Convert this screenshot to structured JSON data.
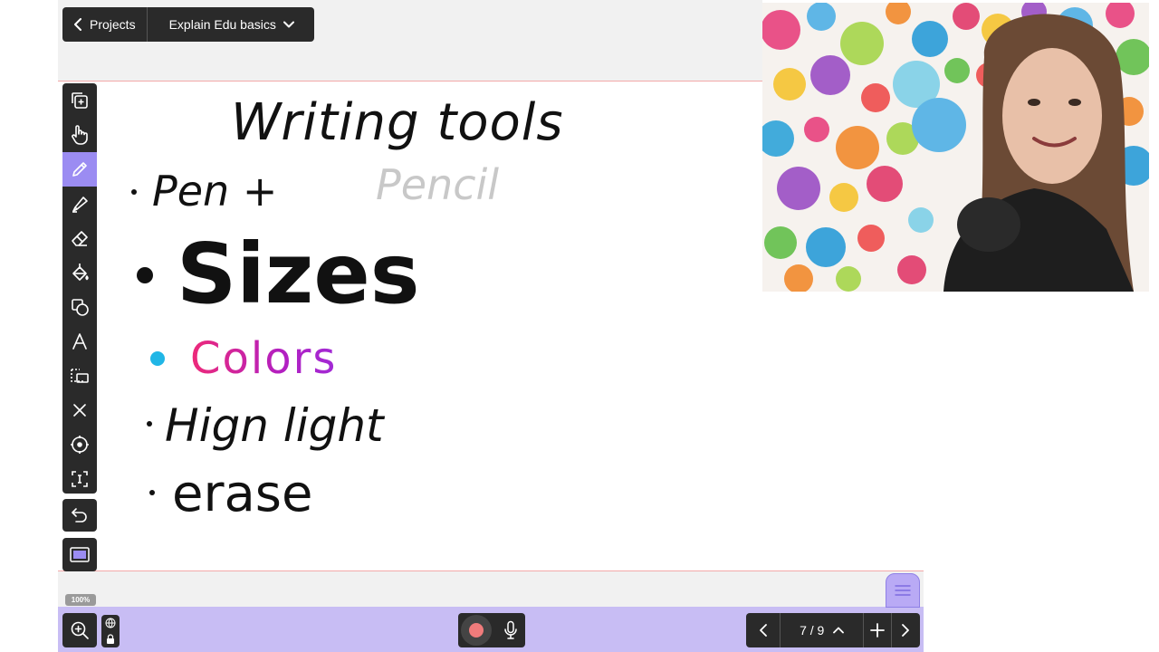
{
  "header": {
    "back_label": "Projects",
    "project_title": "Explain Edu basics"
  },
  "toolbar": {
    "tools": [
      {
        "name": "Select",
        "icon": "duplicate-select-icon"
      },
      {
        "name": "Hand",
        "icon": "hand-icon"
      },
      {
        "name": "Pen",
        "icon": "pen-icon",
        "active": true
      },
      {
        "name": "Highlighter",
        "icon": "highlighter-icon"
      },
      {
        "name": "Eraser",
        "icon": "eraser-icon"
      },
      {
        "name": "Fill",
        "icon": "fill-bucket-icon"
      },
      {
        "name": "Shapes",
        "icon": "shapes-icon"
      },
      {
        "name": "Text",
        "icon": "text-icon"
      },
      {
        "name": "Lasso",
        "icon": "lasso-icon"
      },
      {
        "name": "Delete",
        "icon": "close-icon"
      },
      {
        "name": "Laser",
        "icon": "crosshair-icon"
      },
      {
        "name": "Insert",
        "icon": "insert-icon"
      }
    ],
    "undo_icon": "undo-icon",
    "screen_icon": "screen-icon"
  },
  "board": {
    "title": "Writing tools",
    "items": [
      {
        "text": "Pen +",
        "extra": "Pencil",
        "ink": "#111111",
        "extra_ink": "#c8c8c8"
      },
      {
        "text": "Sizes",
        "ink": "#111111"
      },
      {
        "text": "Colors",
        "ink": "#d8248f",
        "bullet_color": "#20b6e6"
      },
      {
        "text": "Hign light",
        "ink": "#111111"
      },
      {
        "text": "erase",
        "ink": "#111111"
      }
    ]
  },
  "footer": {
    "zoom_level": "100%",
    "page_current": "7",
    "page_total": "9",
    "page_indicator": "7 / 9",
    "accent": "#c8bdf4",
    "record_color": "#f07b7b"
  },
  "colors": {
    "toolbar_bg": "#2a2a2a",
    "active_tool": "#9b8cf2",
    "canvas_margin_line": "#f3a9a9"
  }
}
